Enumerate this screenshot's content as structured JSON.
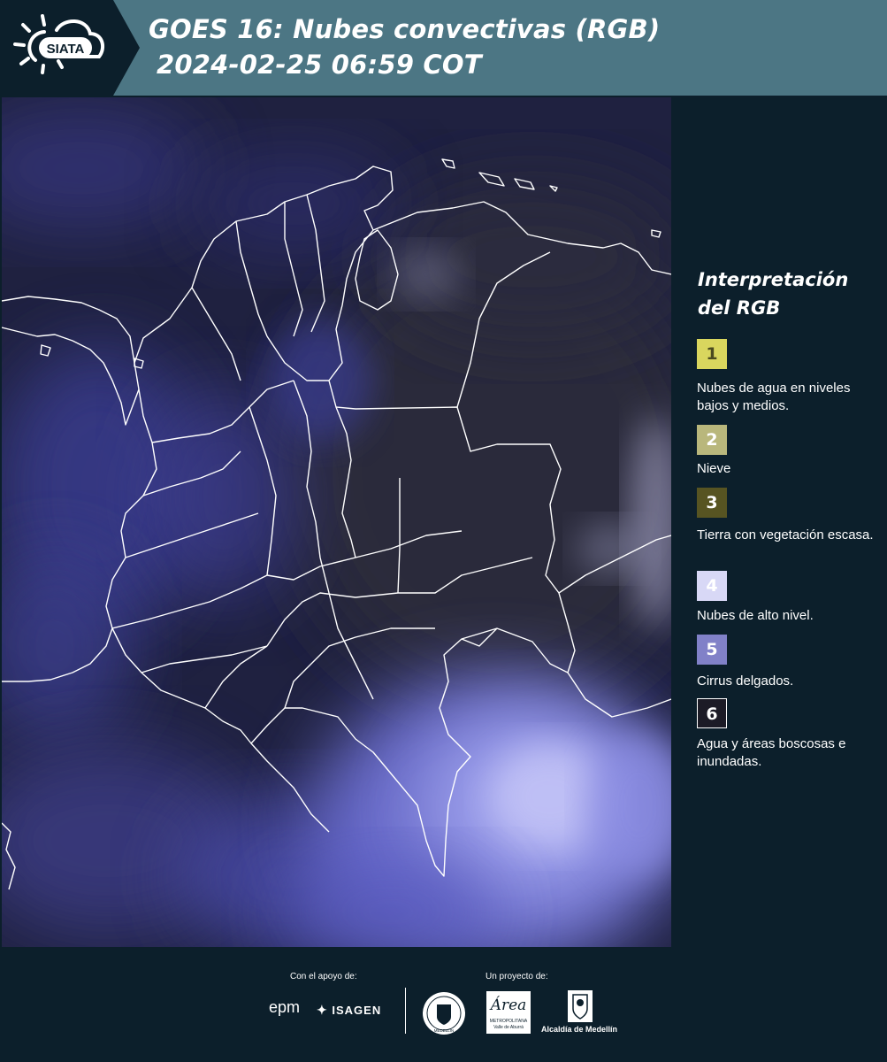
{
  "header": {
    "logo_text": "SIATA",
    "title_line1": "GOES 16: Nubes convectivas (RGB)",
    "title_line2": "2024-02-25 06:59 COT"
  },
  "legend": {
    "title": "Interpretación del RGB",
    "items": [
      {
        "number": "1",
        "label": "Nubes de agua en niveles bajos y medios.",
        "color": "#d9d65e",
        "text_color": "#4a4a20"
      },
      {
        "number": "2",
        "label": "Nieve",
        "color": "#b9b77c",
        "text_color": "#ffffff"
      },
      {
        "number": "3",
        "label": "Tierra con vegetación escasa.",
        "color": "#575422",
        "text_color": "#ffffff"
      },
      {
        "number": "4",
        "label": "Nubes de alto nivel.",
        "color": "#d8d8f6",
        "text_color": "#ffffff"
      },
      {
        "number": "5",
        "label": "Cirrus delgados.",
        "color": "#8181c8",
        "text_color": "#ffffff"
      },
      {
        "number": "6",
        "label": "Agua y áreas boscosas e inundadas.",
        "color": "#1c1b26",
        "text_color": "#ffffff"
      }
    ]
  },
  "footer": {
    "support_label": "Con el apoyo de:",
    "project_label": "Un proyecto de:",
    "sponsor_epm": "epm",
    "sponsor_isagen": "ISAGEN",
    "area_text": "Área",
    "area_subtitle": "METROPOLITANA",
    "area_subtitle2": "Valle de Aburrá",
    "alcaldia": "Alcaldía de Medellín",
    "seal_text": "MEDELLÍN"
  },
  "colors": {
    "header_bg": "#4c7684",
    "panel_bg": "#0c1f2b",
    "map_base": "#1f2140",
    "cloud_high": "#c8c8f8"
  }
}
